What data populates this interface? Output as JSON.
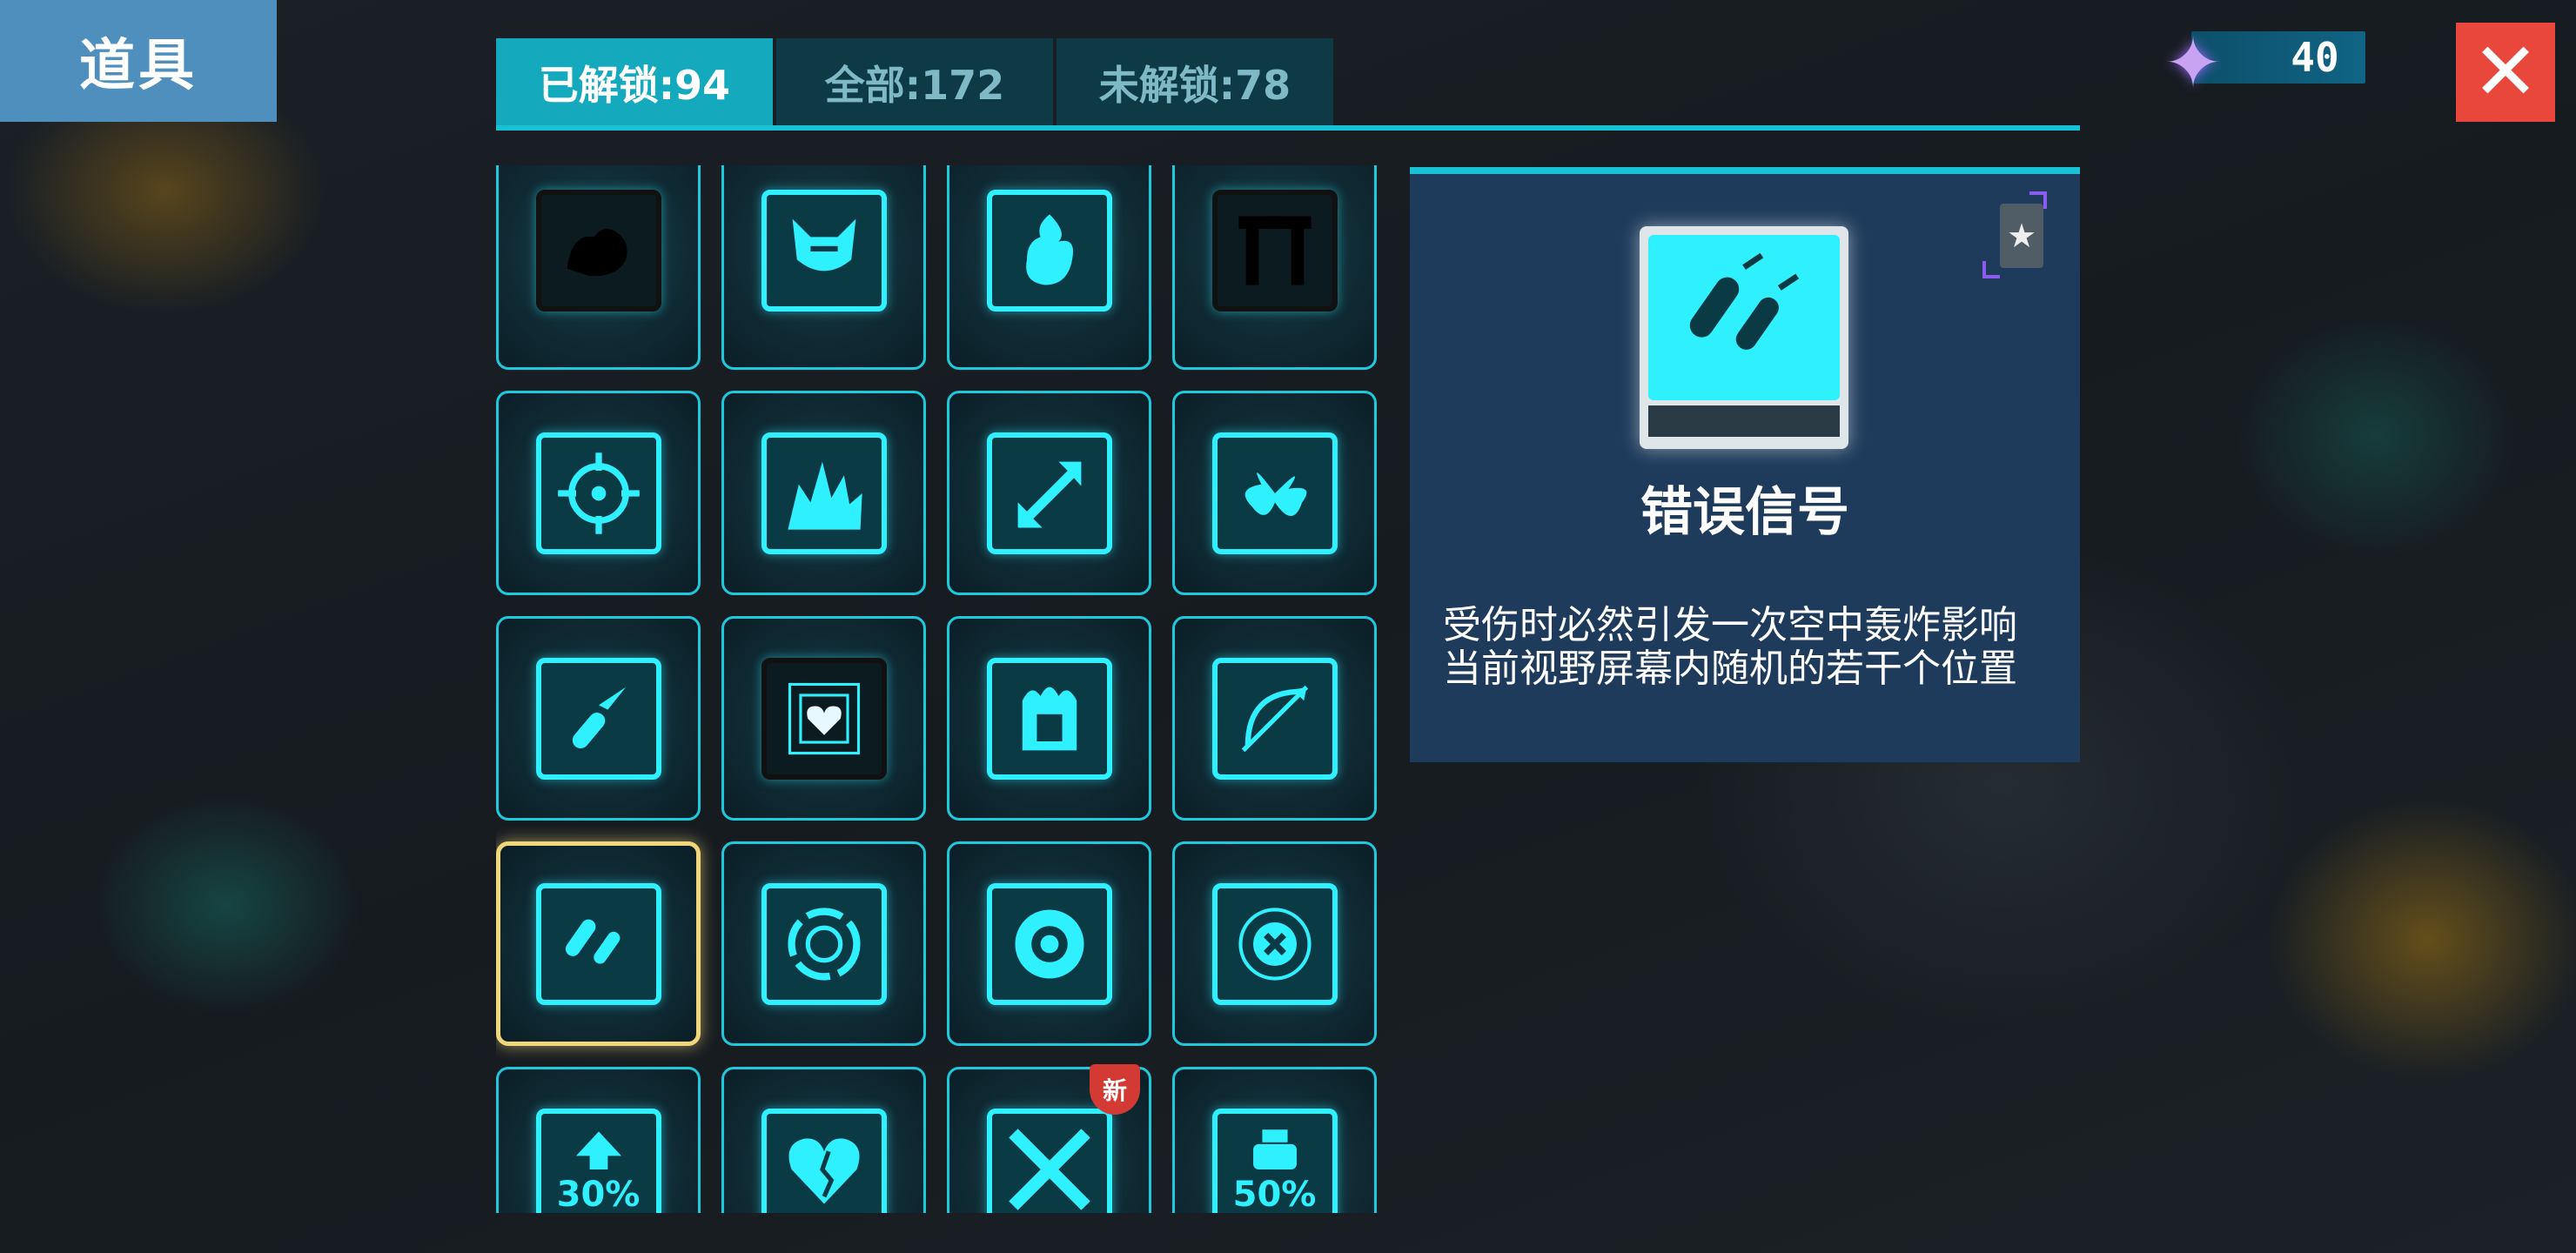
{
  "header": {
    "title": "道具"
  },
  "tabs": [
    {
      "label": "已解锁:94",
      "active": true
    },
    {
      "label": "全部:172",
      "active": false
    },
    {
      "label": "未解锁:78",
      "active": false
    }
  ],
  "currency": {
    "icon": "purple-star-gem-icon",
    "value": "40"
  },
  "close": {
    "icon": "close-icon",
    "label": "✕"
  },
  "items": [
    {
      "icon": "muscle-arm-icon",
      "dark": true
    },
    {
      "icon": "horned-helmet-icon"
    },
    {
      "icon": "fire-hand-icon"
    },
    {
      "icon": "gate-icon",
      "dark": true
    },
    {
      "icon": "crosshair-target-icon"
    },
    {
      "icon": "explosion-burst-icon"
    },
    {
      "icon": "diagonal-arrow-icon"
    },
    {
      "icon": "fan-blades-icon"
    },
    {
      "icon": "bullet-missile-icon"
    },
    {
      "icon": "heart-core-icon",
      "dark": true
    },
    {
      "icon": "burning-crate-icon"
    },
    {
      "icon": "bow-arrow-icon"
    },
    {
      "icon": "falling-bombs-icon",
      "selected": true
    },
    {
      "icon": "shield-ring-icon"
    },
    {
      "icon": "radiation-icon"
    },
    {
      "icon": "cross-circle-icon"
    },
    {
      "icon": "arrow-up-30-icon",
      "text": "30%"
    },
    {
      "icon": "broken-heart-icon"
    },
    {
      "icon": "crossed-blades-icon",
      "badge": "新"
    },
    {
      "icon": "canister-50-icon",
      "text": "50%"
    }
  ],
  "detail": {
    "icon": "falling-bombs-icon",
    "rank_icon": "star-medal-icon",
    "name": "错误信号",
    "description": "受伤时必然引发一次空中轰炸影响当前视野屏幕内随机的若干个位置"
  },
  "colors": {
    "accent": "#18c1d4",
    "glow": "#2ff0ff",
    "selected": "#f1d77c",
    "close": "#e9473b",
    "panel": "#1f3b5c"
  }
}
